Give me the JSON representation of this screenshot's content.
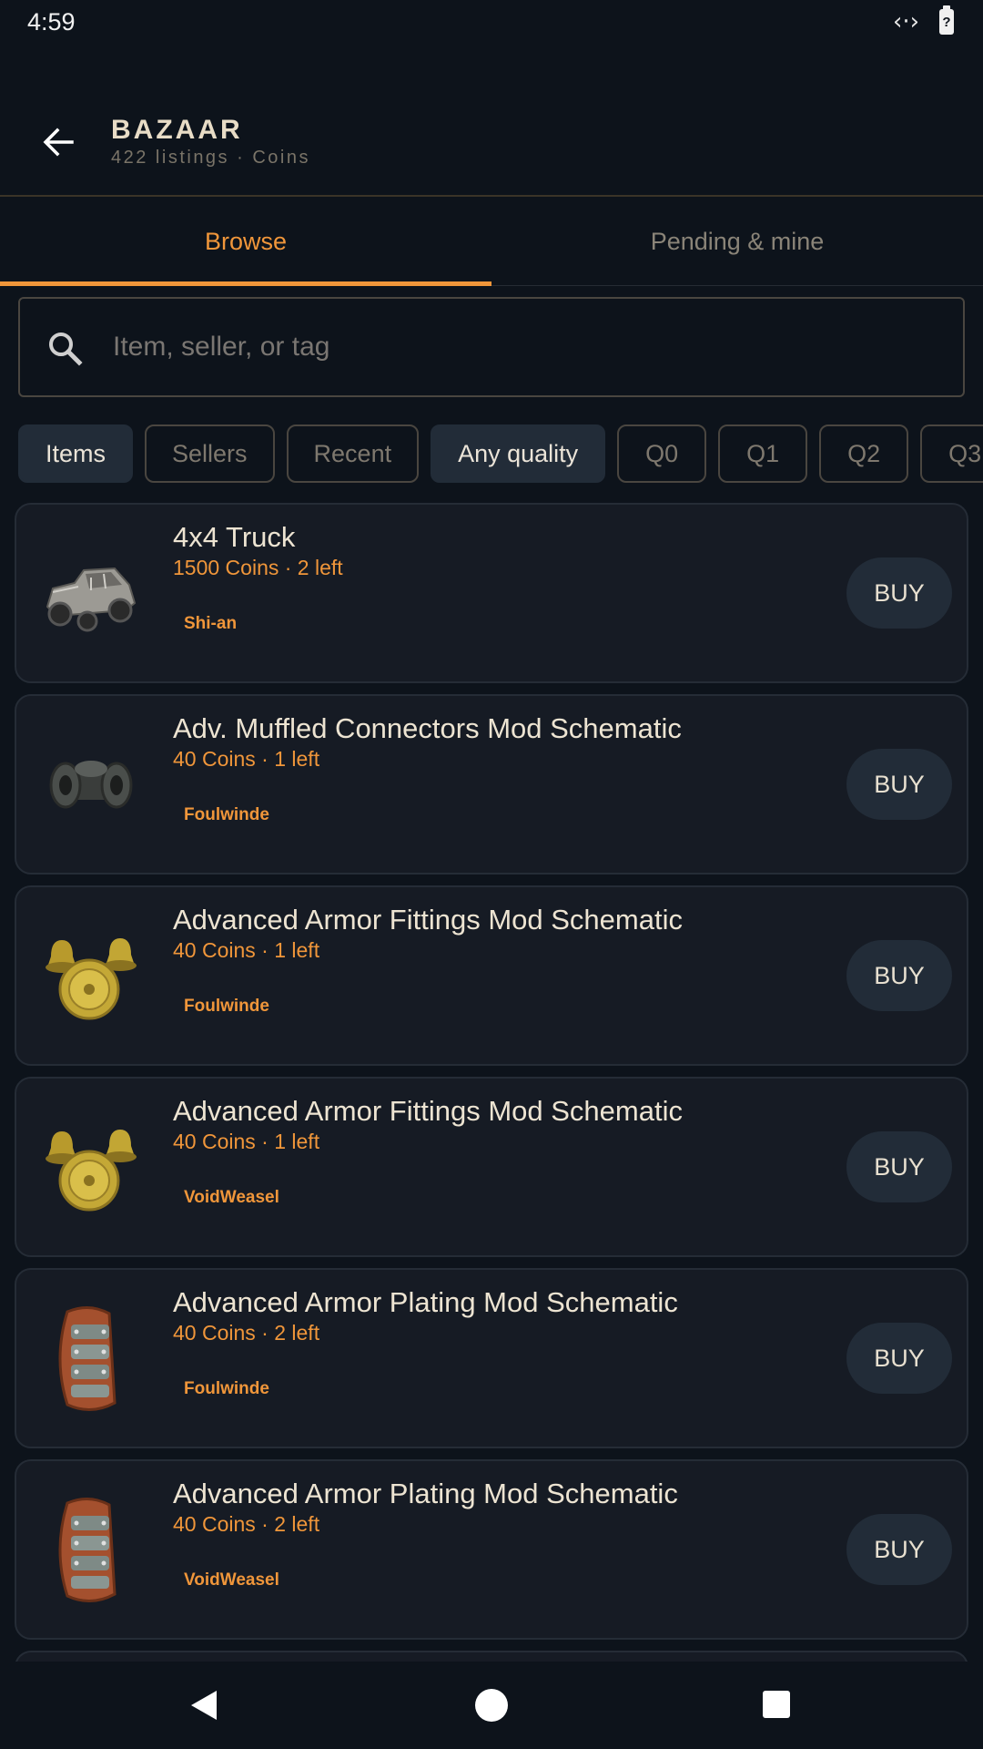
{
  "status": {
    "time": "4:59",
    "battery_glyph": "?"
  },
  "header": {
    "title": "BAZAAR",
    "subtitle": "422 listings · Coins"
  },
  "tabs": [
    {
      "label": "Browse",
      "active": true
    },
    {
      "label": "Pending & mine",
      "active": false
    }
  ],
  "search": {
    "placeholder": "Item, seller, or tag",
    "value": ""
  },
  "chips": {
    "items": "Items",
    "sellers": "Sellers",
    "recent": "Recent",
    "quality": "Any quality",
    "q0": "Q0",
    "q1": "Q1",
    "q2": "Q2",
    "q3": "Q3"
  },
  "listings": [
    {
      "name": "4x4 Truck",
      "price": "1500 Coins · 2 left",
      "seller": "Shi-an",
      "icon": "truck-icon",
      "buy": "BUY"
    },
    {
      "name": "Adv. Muffled Connectors Mod Schematic",
      "price": "40 Coins · 1 left",
      "seller": "Foulwinde",
      "icon": "connector-icon",
      "buy": "BUY"
    },
    {
      "name": "Advanced Armor Fittings Mod Schematic",
      "price": "40 Coins · 1 left",
      "seller": "Foulwinde",
      "icon": "brass-fittings-icon",
      "buy": "BUY"
    },
    {
      "name": "Advanced Armor Fittings Mod Schematic",
      "price": "40 Coins · 1 left",
      "seller": "VoidWeasel",
      "icon": "brass-fittings-icon",
      "buy": "BUY"
    },
    {
      "name": "Advanced Armor Plating Mod Schematic",
      "price": "40 Coins · 2 left",
      "seller": "Foulwinde",
      "icon": "armor-plating-icon",
      "buy": "BUY"
    },
    {
      "name": "Advanced Armor Plating Mod Schematic",
      "price": "40 Coins · 2 left",
      "seller": "VoidWeasel",
      "icon": "armor-plating-icon",
      "buy": "BUY"
    }
  ],
  "colors": {
    "accent": "#f0963a",
    "background": "#0d131b",
    "card": "#161b24",
    "chip_selected": "#222c38"
  }
}
